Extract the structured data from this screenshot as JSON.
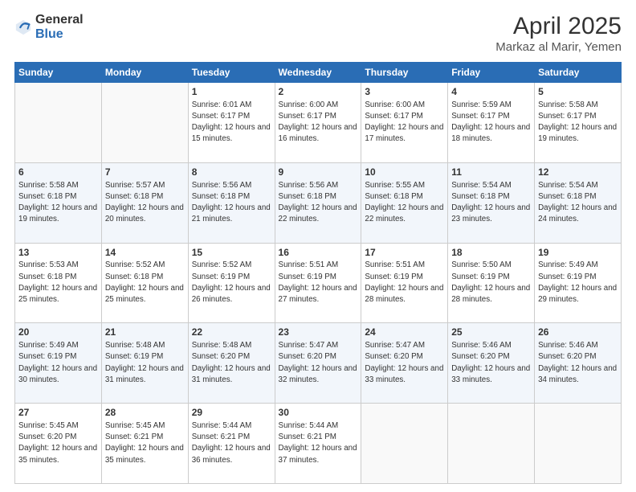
{
  "logo": {
    "general": "General",
    "blue": "Blue"
  },
  "title": {
    "month": "April 2025",
    "location": "Markaz al Marir, Yemen"
  },
  "weekdays": [
    "Sunday",
    "Monday",
    "Tuesday",
    "Wednesday",
    "Thursday",
    "Friday",
    "Saturday"
  ],
  "weeks": [
    [
      {
        "day": null
      },
      {
        "day": null
      },
      {
        "day": 1,
        "sunrise": "Sunrise: 6:01 AM",
        "sunset": "Sunset: 6:17 PM",
        "daylight": "Daylight: 12 hours and 15 minutes."
      },
      {
        "day": 2,
        "sunrise": "Sunrise: 6:00 AM",
        "sunset": "Sunset: 6:17 PM",
        "daylight": "Daylight: 12 hours and 16 minutes."
      },
      {
        "day": 3,
        "sunrise": "Sunrise: 6:00 AM",
        "sunset": "Sunset: 6:17 PM",
        "daylight": "Daylight: 12 hours and 17 minutes."
      },
      {
        "day": 4,
        "sunrise": "Sunrise: 5:59 AM",
        "sunset": "Sunset: 6:17 PM",
        "daylight": "Daylight: 12 hours and 18 minutes."
      },
      {
        "day": 5,
        "sunrise": "Sunrise: 5:58 AM",
        "sunset": "Sunset: 6:17 PM",
        "daylight": "Daylight: 12 hours and 19 minutes."
      }
    ],
    [
      {
        "day": 6,
        "sunrise": "Sunrise: 5:58 AM",
        "sunset": "Sunset: 6:18 PM",
        "daylight": "Daylight: 12 hours and 19 minutes."
      },
      {
        "day": 7,
        "sunrise": "Sunrise: 5:57 AM",
        "sunset": "Sunset: 6:18 PM",
        "daylight": "Daylight: 12 hours and 20 minutes."
      },
      {
        "day": 8,
        "sunrise": "Sunrise: 5:56 AM",
        "sunset": "Sunset: 6:18 PM",
        "daylight": "Daylight: 12 hours and 21 minutes."
      },
      {
        "day": 9,
        "sunrise": "Sunrise: 5:56 AM",
        "sunset": "Sunset: 6:18 PM",
        "daylight": "Daylight: 12 hours and 22 minutes."
      },
      {
        "day": 10,
        "sunrise": "Sunrise: 5:55 AM",
        "sunset": "Sunset: 6:18 PM",
        "daylight": "Daylight: 12 hours and 22 minutes."
      },
      {
        "day": 11,
        "sunrise": "Sunrise: 5:54 AM",
        "sunset": "Sunset: 6:18 PM",
        "daylight": "Daylight: 12 hours and 23 minutes."
      },
      {
        "day": 12,
        "sunrise": "Sunrise: 5:54 AM",
        "sunset": "Sunset: 6:18 PM",
        "daylight": "Daylight: 12 hours and 24 minutes."
      }
    ],
    [
      {
        "day": 13,
        "sunrise": "Sunrise: 5:53 AM",
        "sunset": "Sunset: 6:18 PM",
        "daylight": "Daylight: 12 hours and 25 minutes."
      },
      {
        "day": 14,
        "sunrise": "Sunrise: 5:52 AM",
        "sunset": "Sunset: 6:18 PM",
        "daylight": "Daylight: 12 hours and 25 minutes."
      },
      {
        "day": 15,
        "sunrise": "Sunrise: 5:52 AM",
        "sunset": "Sunset: 6:19 PM",
        "daylight": "Daylight: 12 hours and 26 minutes."
      },
      {
        "day": 16,
        "sunrise": "Sunrise: 5:51 AM",
        "sunset": "Sunset: 6:19 PM",
        "daylight": "Daylight: 12 hours and 27 minutes."
      },
      {
        "day": 17,
        "sunrise": "Sunrise: 5:51 AM",
        "sunset": "Sunset: 6:19 PM",
        "daylight": "Daylight: 12 hours and 28 minutes."
      },
      {
        "day": 18,
        "sunrise": "Sunrise: 5:50 AM",
        "sunset": "Sunset: 6:19 PM",
        "daylight": "Daylight: 12 hours and 28 minutes."
      },
      {
        "day": 19,
        "sunrise": "Sunrise: 5:49 AM",
        "sunset": "Sunset: 6:19 PM",
        "daylight": "Daylight: 12 hours and 29 minutes."
      }
    ],
    [
      {
        "day": 20,
        "sunrise": "Sunrise: 5:49 AM",
        "sunset": "Sunset: 6:19 PM",
        "daylight": "Daylight: 12 hours and 30 minutes."
      },
      {
        "day": 21,
        "sunrise": "Sunrise: 5:48 AM",
        "sunset": "Sunset: 6:19 PM",
        "daylight": "Daylight: 12 hours and 31 minutes."
      },
      {
        "day": 22,
        "sunrise": "Sunrise: 5:48 AM",
        "sunset": "Sunset: 6:20 PM",
        "daylight": "Daylight: 12 hours and 31 minutes."
      },
      {
        "day": 23,
        "sunrise": "Sunrise: 5:47 AM",
        "sunset": "Sunset: 6:20 PM",
        "daylight": "Daylight: 12 hours and 32 minutes."
      },
      {
        "day": 24,
        "sunrise": "Sunrise: 5:47 AM",
        "sunset": "Sunset: 6:20 PM",
        "daylight": "Daylight: 12 hours and 33 minutes."
      },
      {
        "day": 25,
        "sunrise": "Sunrise: 5:46 AM",
        "sunset": "Sunset: 6:20 PM",
        "daylight": "Daylight: 12 hours and 33 minutes."
      },
      {
        "day": 26,
        "sunrise": "Sunrise: 5:46 AM",
        "sunset": "Sunset: 6:20 PM",
        "daylight": "Daylight: 12 hours and 34 minutes."
      }
    ],
    [
      {
        "day": 27,
        "sunrise": "Sunrise: 5:45 AM",
        "sunset": "Sunset: 6:20 PM",
        "daylight": "Daylight: 12 hours and 35 minutes."
      },
      {
        "day": 28,
        "sunrise": "Sunrise: 5:45 AM",
        "sunset": "Sunset: 6:21 PM",
        "daylight": "Daylight: 12 hours and 35 minutes."
      },
      {
        "day": 29,
        "sunrise": "Sunrise: 5:44 AM",
        "sunset": "Sunset: 6:21 PM",
        "daylight": "Daylight: 12 hours and 36 minutes."
      },
      {
        "day": 30,
        "sunrise": "Sunrise: 5:44 AM",
        "sunset": "Sunset: 6:21 PM",
        "daylight": "Daylight: 12 hours and 37 minutes."
      },
      {
        "day": null
      },
      {
        "day": null
      },
      {
        "day": null
      }
    ]
  ]
}
